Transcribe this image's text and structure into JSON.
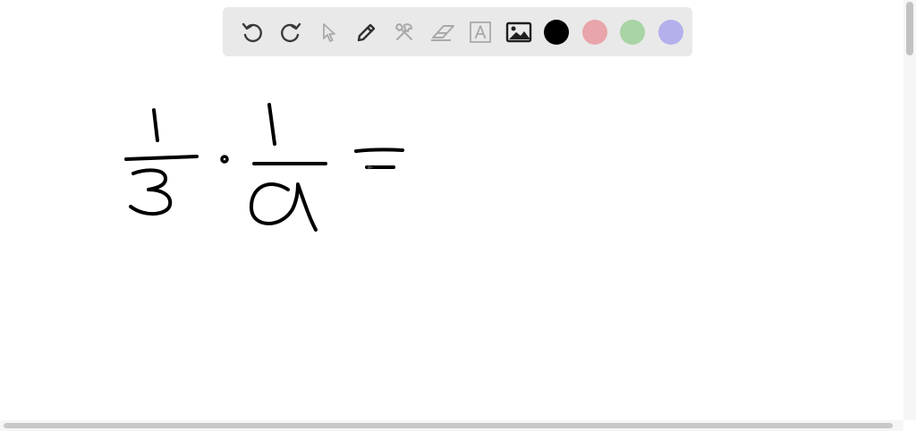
{
  "toolbar": {
    "tools": [
      {
        "icon": "undo-icon"
      },
      {
        "icon": "redo-icon"
      },
      {
        "icon": "select-pointer-icon"
      },
      {
        "icon": "pen-icon"
      },
      {
        "icon": "tools-icon"
      },
      {
        "icon": "eraser-icon"
      },
      {
        "icon": "text-box-icon"
      },
      {
        "icon": "image-icon"
      }
    ],
    "colors": [
      {
        "name": "black",
        "hex": "#000000",
        "selected": true
      },
      {
        "name": "pink",
        "hex": "#e8a5ab"
      },
      {
        "name": "green",
        "hex": "#a8d4a6"
      },
      {
        "name": "lavender",
        "hex": "#b3b0ec"
      }
    ]
  },
  "canvas": {
    "handwriting": "1/3 · 1/a ="
  }
}
